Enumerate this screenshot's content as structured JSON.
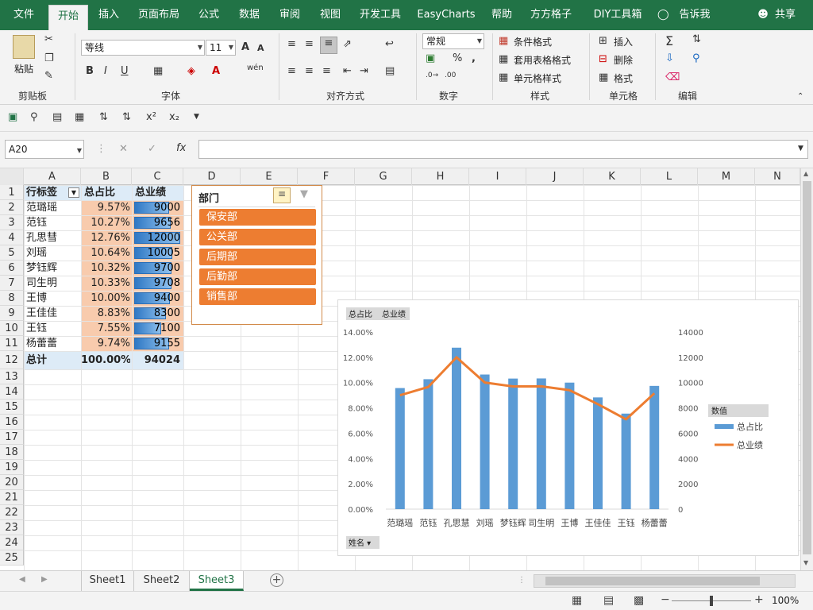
{
  "tabs": [
    "文件",
    "开始",
    "插入",
    "页面布局",
    "公式",
    "数据",
    "审阅",
    "视图",
    "开发工具",
    "EasyCharts",
    "帮助",
    "方方格子",
    "DIY工具箱",
    "告诉我",
    "共享"
  ],
  "ribbon": {
    "clipboard": {
      "paste": "粘贴",
      "label": "剪贴板"
    },
    "font": {
      "name": "等线",
      "size": "11",
      "bold": "B",
      "italic": "I",
      "underline": "U",
      "label": "字体"
    },
    "alignment": {
      "label": "对齐方式"
    },
    "number": {
      "format": "常规",
      "percent": "%",
      "comma": ",",
      "label": "数字"
    },
    "styles": {
      "cond": "条件格式",
      "table": "套用表格格式",
      "cell": "单元格样式",
      "label": "样式"
    },
    "cells": {
      "insert": "插入",
      "delete": "删除",
      "format": "格式",
      "label": "单元格"
    },
    "editing": {
      "label": "编辑"
    }
  },
  "formula": {
    "namebox": "A20",
    "fx": "fx",
    "value": ""
  },
  "columns": [
    "A",
    "B",
    "C",
    "D",
    "E",
    "F",
    "G",
    "H",
    "I",
    "J",
    "K",
    "L",
    "M",
    "N"
  ],
  "rows": [
    "1",
    "2",
    "3",
    "4",
    "5",
    "6",
    "7",
    "8",
    "9",
    "10",
    "11",
    "12",
    "13",
    "14",
    "15",
    "16",
    "17",
    "18",
    "19",
    "20",
    "21",
    "22",
    "23",
    "24",
    "25"
  ],
  "pivot": {
    "headers": [
      "行标签",
      "总占比",
      "总业绩"
    ],
    "data": [
      {
        "name": "范璐瑶",
        "pct": "9.57%",
        "val": "9000",
        "bar": 0.75
      },
      {
        "name": "范钰",
        "pct": "10.27%",
        "val": "9656",
        "bar": 0.8
      },
      {
        "name": "孔思彗",
        "pct": "12.76%",
        "val": "12000",
        "bar": 1.0
      },
      {
        "name": "刘瑶",
        "pct": "10.64%",
        "val": "10005",
        "bar": 0.83
      },
      {
        "name": "梦钰辉",
        "pct": "10.32%",
        "val": "9700",
        "bar": 0.81
      },
      {
        "name": "司生明",
        "pct": "10.33%",
        "val": "9708",
        "bar": 0.81
      },
      {
        "name": "王博",
        "pct": "10.00%",
        "val": "9400",
        "bar": 0.78
      },
      {
        "name": "王佳佳",
        "pct": "8.83%",
        "val": "8300",
        "bar": 0.69
      },
      {
        "name": "王钰",
        "pct": "7.55%",
        "val": "7100",
        "bar": 0.59
      },
      {
        "name": "杨蕾蕾",
        "pct": "9.74%",
        "val": "9155",
        "bar": 0.76
      }
    ],
    "total": {
      "label": "总计",
      "pct": "100.00%",
      "val": "94024"
    }
  },
  "slicer": {
    "title": "部门",
    "items": [
      "保安部",
      "公关部",
      "后期部",
      "后勤部",
      "销售部"
    ]
  },
  "chart_data": {
    "type": "bar",
    "field_buttons": [
      "总占比",
      "总业绩"
    ],
    "axis_button": "姓名",
    "categories": [
      "范璐瑶",
      "范钰",
      "孔思慧",
      "刘瑶",
      "梦钰辉",
      "司生明",
      "王博",
      "王佳佳",
      "王钰",
      "杨蕾蕾"
    ],
    "series": [
      {
        "name": "总占比",
        "type": "bar",
        "axis": "left",
        "values": [
          9.57,
          10.27,
          12.76,
          10.64,
          10.32,
          10.33,
          10.0,
          8.83,
          7.55,
          9.74
        ],
        "color": "#5b9bd5"
      },
      {
        "name": "总业绩",
        "type": "line",
        "axis": "right",
        "values": [
          9000,
          9656,
          12000,
          10005,
          9700,
          9708,
          9400,
          8300,
          7100,
          9155
        ],
        "color": "#ed7d31"
      }
    ],
    "left_ticks": [
      "0.00%",
      "2.00%",
      "4.00%",
      "6.00%",
      "8.00%",
      "10.00%",
      "12.00%",
      "14.00%"
    ],
    "right_ticks": [
      "0",
      "2000",
      "4000",
      "6000",
      "8000",
      "10000",
      "12000",
      "14000"
    ],
    "ylim_left": [
      0,
      14
    ],
    "ylim_right": [
      0,
      14000
    ],
    "legend_title": "数值",
    "legend_position": "right",
    "grid": false
  },
  "sheets": [
    "Sheet1",
    "Sheet2",
    "Sheet3"
  ],
  "active_sheet": "Sheet3",
  "status": {
    "zoom": "100%"
  }
}
